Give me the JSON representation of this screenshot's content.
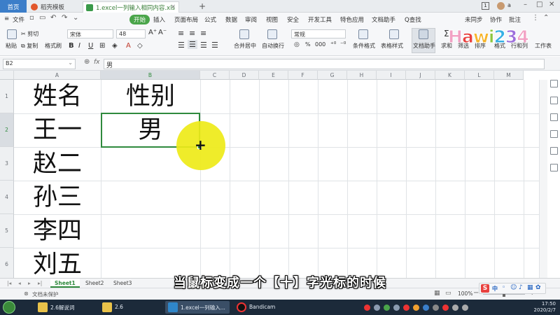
{
  "titlebar": {
    "home_tab": "首页",
    "template_tab": "稻壳模板",
    "file_tab": "1.excel一列输入相同内容.xls",
    "close": "×",
    "new_tab": "+",
    "sign_in": "a",
    "page_num": "1"
  },
  "menu": {
    "file": "文件",
    "start": "开始",
    "items": [
      "插入",
      "页面布局",
      "公式",
      "数据",
      "审阅",
      "视图",
      "安全",
      "开发工具",
      "特色应用",
      "文档助手"
    ],
    "search": "Q查找",
    "sync": "未同步",
    "collab": "协作",
    "comment": "批注"
  },
  "toolbar": {
    "paste": "粘贴",
    "cut": "剪切",
    "copy": "复制",
    "format_painter": "格式刷",
    "font_name": "宋体",
    "font_size": "48",
    "merge_center": "合并居中",
    "wrap_text": "自动换行",
    "number_format": "常规",
    "conditional": "条件格式",
    "table_style": "表格样式",
    "doc_helper": "文档助手",
    "sum": "求和",
    "filter": "筛选",
    "sort": "排序",
    "format": "格式",
    "row_col": "行和列",
    "worksheet": "工作表",
    "percent": "%",
    "thousands": "000"
  },
  "logo": {
    "text": "Hawi234",
    "colors": [
      "#f2a1c4",
      "#e8413e",
      "#f7b52c",
      "#8cc63f",
      "#36b0e5",
      "#9d6fdc",
      "#f2a1c4"
    ]
  },
  "formula": {
    "cell_ref": "B2",
    "fx": "fx",
    "value": "男"
  },
  "grid": {
    "columns": [
      "A",
      "B",
      "C",
      "D",
      "E",
      "F",
      "G",
      "H",
      "I",
      "J",
      "K",
      "L",
      "M"
    ],
    "rows": [
      "1",
      "2",
      "3",
      "4",
      "5",
      "6"
    ],
    "cells": {
      "A1": "姓名",
      "B1": "性别",
      "A2": "王一",
      "B2": "男",
      "A3": "赵二",
      "A4": "孙三",
      "A5": "李四",
      "A6": "刘五"
    }
  },
  "cursor": {
    "glyph": "+"
  },
  "sheets": [
    "Sheet1",
    "Sheet2",
    "Sheet3"
  ],
  "status": {
    "protect": "文档未保护",
    "zoom": "100%",
    "minus": "−",
    "plus": "+"
  },
  "caption": "当鼠标变成一个【十】字光标的时候",
  "taskbar": {
    "items": [
      "2.6解说词",
      "2.6",
      "1.excel一列输入...",
      "Bandicam"
    ],
    "date": "2020/2/7",
    "time": "17:50",
    "ime": "中"
  }
}
